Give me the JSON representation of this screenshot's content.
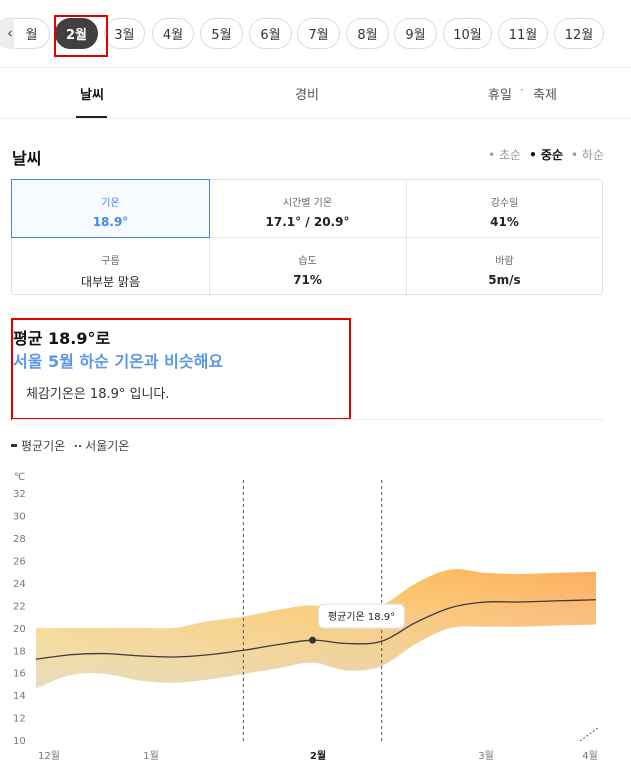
{
  "months": {
    "scroll_icon": "chevron-left-icon",
    "items": [
      "월",
      "2월",
      "3월",
      "4월",
      "5월",
      "6월",
      "7월",
      "8월",
      "9월",
      "10월",
      "11월",
      "12월"
    ],
    "active_index": 1
  },
  "tabs": {
    "weather": "날씨",
    "cost": "경비",
    "holiday": "휴일",
    "dot": "·",
    "festival": "축제"
  },
  "weather": {
    "title": "날씨",
    "period": [
      "• 초순",
      "• 중순",
      "• 하순"
    ],
    "active_period_index": 1,
    "stats": [
      {
        "label": "기온",
        "value": "18.9°"
      },
      {
        "label": "시간별 기온",
        "value": "17.1° / 20.9°"
      },
      {
        "label": "강수일",
        "value": "41%"
      },
      {
        "label": "구름",
        "value": "대부분 맑음"
      },
      {
        "label": "습도",
        "value": "71%"
      },
      {
        "label": "바람",
        "value": "5m/s"
      }
    ]
  },
  "summary": {
    "line1": "평균 18.9°로",
    "line2": "서울 5월 하순 기온과 비슷해요",
    "line3": "체감기온은 18.9° 입니다."
  },
  "legend": {
    "avg": "평균기온",
    "seoul": "서울기온"
  },
  "chart_data": {
    "type": "area",
    "unit_label": "℃",
    "y_ticks": [
      10,
      12,
      14,
      16,
      18,
      20,
      22,
      24,
      26,
      28,
      30,
      32
    ],
    "ylim": [
      10,
      33
    ],
    "x_labels": [
      "12월",
      "1월",
      "2월",
      "3월",
      "4월"
    ],
    "x_label_positions": [
      0.0,
      1.0,
      2.0,
      3.0,
      4.0
    ],
    "active_x_label": "2월",
    "x": [
      0.0,
      0.25,
      0.5,
      0.75,
      1.0,
      1.25,
      1.5,
      1.75,
      2.0,
      2.25,
      2.5,
      2.75,
      3.0,
      3.25,
      3.5,
      3.75,
      4.05
    ],
    "series": [
      {
        "name": "평균기온",
        "values": [
          17.2,
          17.6,
          17.7,
          17.5,
          17.4,
          17.6,
          18.0,
          18.5,
          18.9,
          18.6,
          18.8,
          20.5,
          21.8,
          22.3,
          22.3,
          22.4,
          22.5
        ],
        "low": [
          14.6,
          15.8,
          15.9,
          15.3,
          15.1,
          15.4,
          15.9,
          16.4,
          16.9,
          16.2,
          16.6,
          18.6,
          20.0,
          20.1,
          20.1,
          20.2,
          20.3
        ],
        "high": [
          20.0,
          20.0,
          20.0,
          20.0,
          20.0,
          20.6,
          21.0,
          21.6,
          22.0,
          21.4,
          22.0,
          24.0,
          25.2,
          24.9,
          24.8,
          24.9,
          25.0
        ]
      }
    ],
    "period_markers": [
      1.5,
      2.5
    ],
    "highlight_point": {
      "x": 2.0,
      "y": 18.9,
      "label": "평균기온 18.9°"
    }
  }
}
